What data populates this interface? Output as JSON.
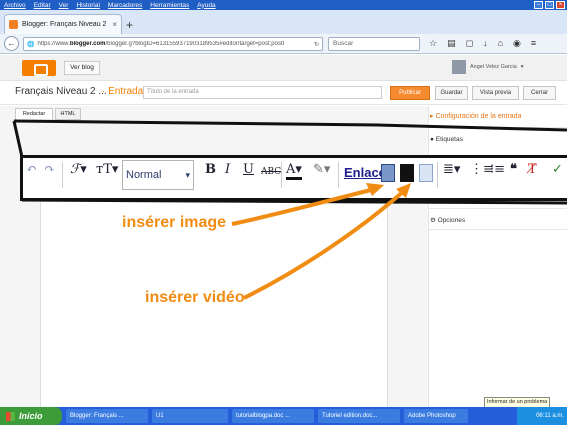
{
  "menubar": [
    "Archivo",
    "Editar",
    "Ver",
    "Historial",
    "Marcadores",
    "Herramientas",
    "Ayuda"
  ],
  "browser": {
    "tab_title": "Blogger: Français Niveau 2 - ...",
    "url_prefix": "https://www.",
    "url_domain": "blogger.com",
    "url_rest": "/blogger.g?blogID=6131559371903189535#editor/target=post;postI",
    "search_placeholder": "Buscar"
  },
  "blogger": {
    "ver_blog": "Ver blog",
    "user_name": "Angel Velez Garcia"
  },
  "post": {
    "blog_name": "Français Niveau 2 ...",
    "separator_label": "· Entrada",
    "title_placeholder": "Título de la entrada",
    "buttons": {
      "publish": "Publicar",
      "save": "Guardar",
      "preview": "Vista previa",
      "close": "Cerrar"
    }
  },
  "editor": {
    "tab_compose": "Redactar",
    "tab_html": "HTML",
    "toolbar": {
      "font_size_value": "Normal",
      "link_label": "Enlace"
    }
  },
  "sidebar": {
    "config_title": "Configuración de la entrada",
    "items": [
      "Etiquetas",
      "Opciones"
    ]
  },
  "annotations": {
    "insert_image": "insérer image",
    "insert_video": "insérer vidéo"
  },
  "taskbar": {
    "start": "Inicio",
    "tasks": [
      "Blogger: Français ...",
      "U1",
      "tutorialblogpa.doc ...",
      "Tutoriel edition.doc...",
      "Adobe Photoshop"
    ],
    "clock": "06:11 a.m.",
    "tooltip": "Informar de un problema"
  },
  "colors": {
    "blogger_orange": "#f57d00",
    "annotation_orange": "#f08c12",
    "taskbar_blue": "#245edb"
  }
}
